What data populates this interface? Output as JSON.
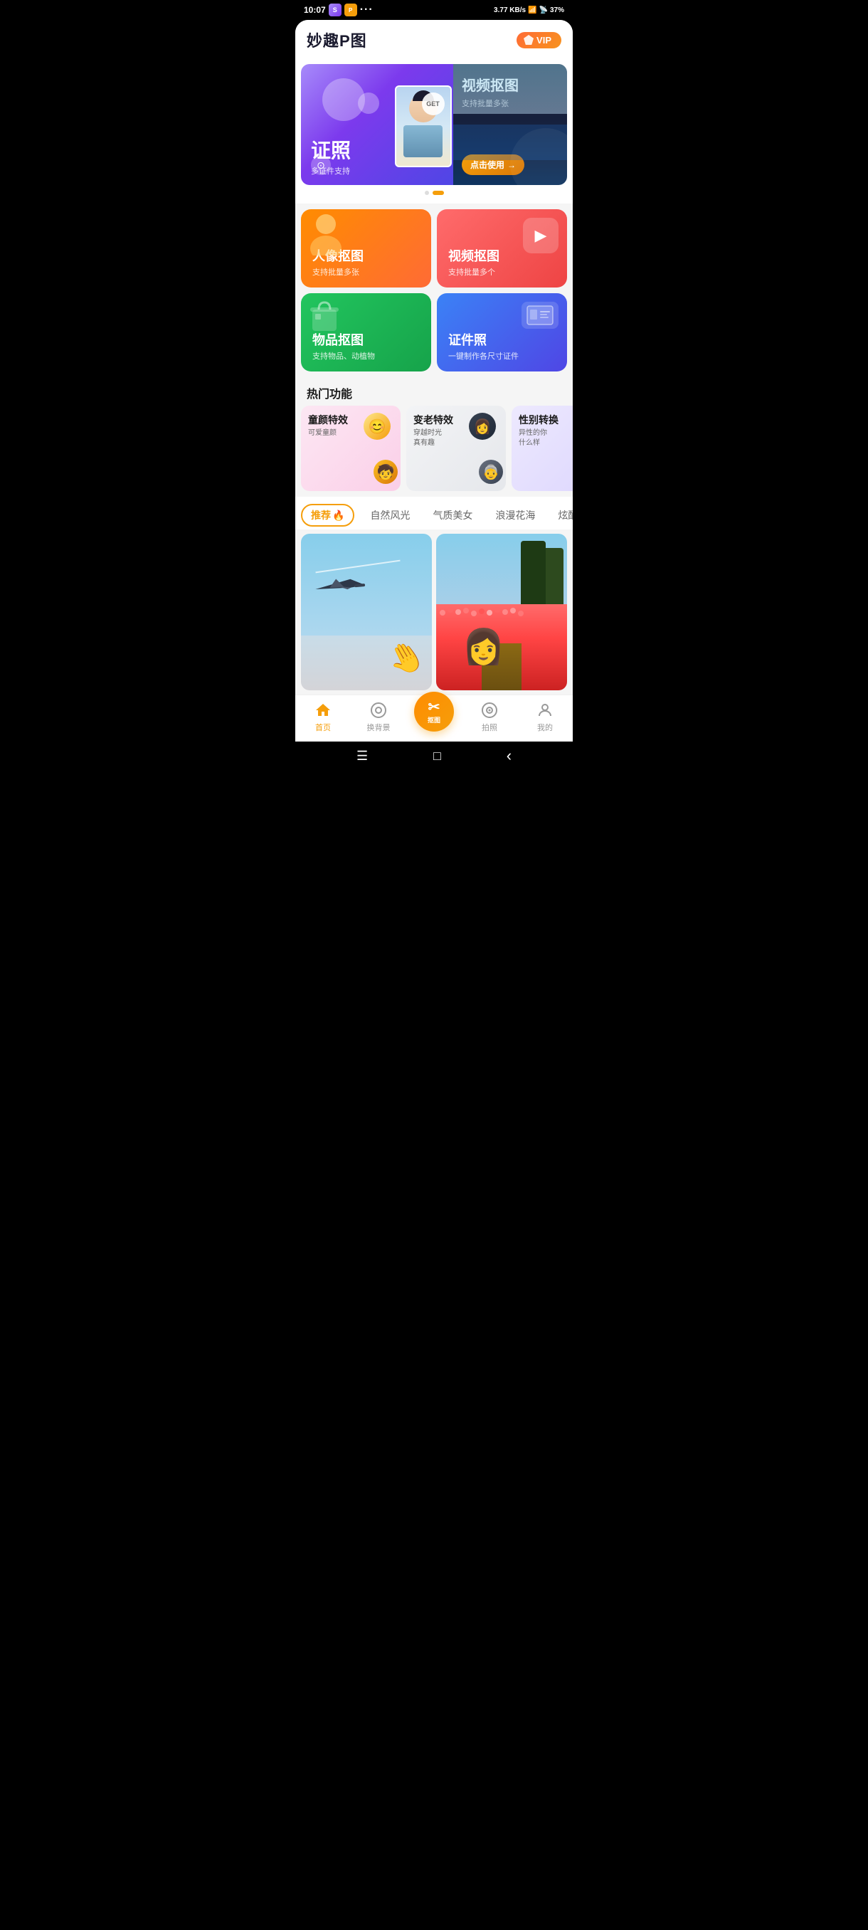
{
  "statusBar": {
    "time": "10:07",
    "network": "3.77 KB/s",
    "battery": "37%"
  },
  "header": {
    "title": "妙趣P图",
    "vipLabel": "VIP"
  },
  "banner": {
    "slide1": {
      "title": "证照",
      "subtitle": "多证件支持",
      "getLabel": "GET"
    },
    "slide2": {
      "title": "视频抠图",
      "subtitle": "支持批量多张",
      "btnLabel": "点击使用"
    }
  },
  "features": [
    {
      "title": "人像抠图",
      "subtitle": "支持批量多张",
      "color": "orange",
      "icon": "👤"
    },
    {
      "title": "视频抠图",
      "subtitle": "支持批量多个",
      "color": "red-orange",
      "icon": "▶"
    },
    {
      "title": "物品抠图",
      "subtitle": "支持物品、动植物",
      "color": "green",
      "icon": "🎒"
    },
    {
      "title": "证件照",
      "subtitle": "一键制作各尺寸证件",
      "color": "blue",
      "icon": "💳"
    }
  ],
  "hotSection": {
    "title": "热门功能",
    "items": [
      {
        "title": "童颜特效",
        "subtitle": "可爱童颜",
        "bg": "hot-bg-1"
      },
      {
        "title": "变老特效",
        "subtitle": "穿越时光\n真有趣",
        "bg": "hot-bg-2"
      },
      {
        "title": "性别转换",
        "subtitle": "异性的你\n什么样",
        "bg": "hot-bg-3"
      }
    ]
  },
  "tabs": [
    {
      "label": "推荐🔥",
      "active": true
    },
    {
      "label": "自然风光",
      "active": false
    },
    {
      "label": "气质美女",
      "active": false
    },
    {
      "label": "浪漫花海",
      "active": false
    },
    {
      "label": "炫酷",
      "active": false
    }
  ],
  "bottomNav": [
    {
      "label": "首页",
      "active": true,
      "icon": "🏠"
    },
    {
      "label": "换背景",
      "active": false,
      "icon": "○"
    },
    {
      "label": "抠图",
      "active": false,
      "icon": "✂",
      "center": true
    },
    {
      "label": "拍照",
      "active": false,
      "icon": "○"
    },
    {
      "label": "我的",
      "active": false,
      "icon": "○"
    }
  ],
  "systemBar": {
    "menu": "☰",
    "home": "□",
    "back": "‹"
  }
}
